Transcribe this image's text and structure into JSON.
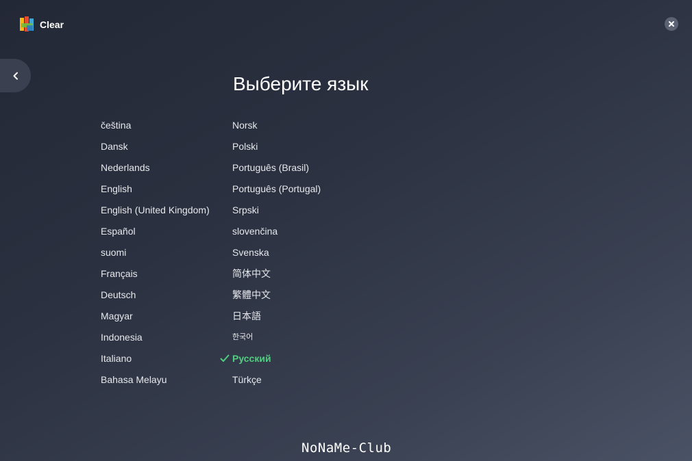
{
  "header": {
    "app_name": "Clear",
    "logo_icon": "avg-logo-icon",
    "close_icon": "close-icon"
  },
  "nav": {
    "back_icon": "chevron-left-icon"
  },
  "main": {
    "title": "Выберите язык",
    "selected_language": "Русский",
    "accent_color": "#4fcf7f",
    "languages_left": [
      "čeština",
      "Dansk",
      "Nederlands",
      "English",
      "English (United Kingdom)",
      "Español",
      "suomi",
      "Français",
      "Deutsch",
      "Magyar",
      "Indonesia",
      "Italiano",
      "Bahasa Melayu"
    ],
    "languages_right": [
      "Norsk",
      "Polski",
      "Português (Brasil)",
      "Português (Portugal)",
      "Srpski",
      "slovenčina",
      "Svenska",
      "简体中文",
      "繁體中文",
      "日本語",
      "한국어",
      "Русский",
      "Türkçe"
    ]
  },
  "footer": {
    "watermark": "NoNaMe-Club"
  }
}
